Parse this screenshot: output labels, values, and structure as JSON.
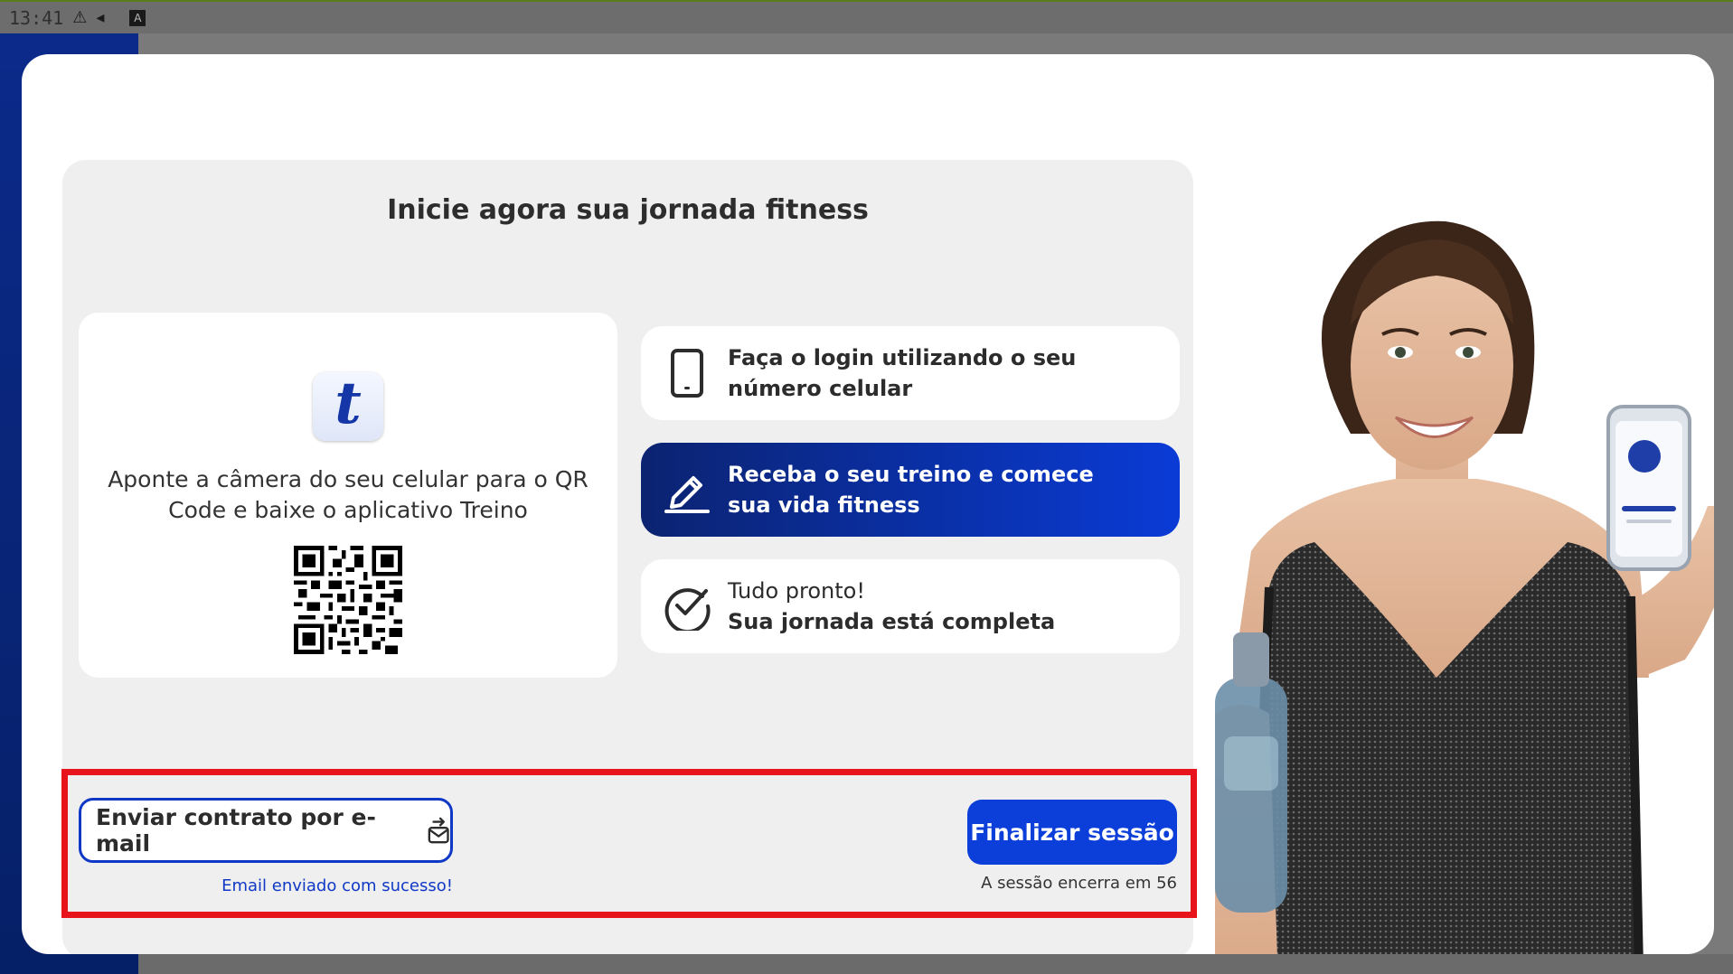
{
  "statusbar": {
    "time": "13:41",
    "warning_icon": "warning-icon",
    "sound_icon": "speaker-icon",
    "app_badge": "A"
  },
  "modal": {
    "title": "Inicie agora sua jornada fitness",
    "qr_card": {
      "logo_letter": "t",
      "instruction": "Aponte a câmera do seu celular para o QR Code e baixe o aplicativo Treino"
    },
    "steps": [
      {
        "icon": "smartphone-icon",
        "text": "Faça o login utilizando o seu número celular",
        "active": false
      },
      {
        "icon": "pencil-icon",
        "text": "Receba o seu treino e comece sua vida fitness",
        "active": true
      },
      {
        "icon": "check-circle-icon",
        "text_line1": "Tudo pronto!",
        "text_line2": "Sua jornada está completa",
        "active": false
      }
    ],
    "actions": {
      "email_button_label": "Enviar contrato por e-mail",
      "email_icon": "mail-send-icon",
      "email_status": "Email enviado com sucesso!",
      "finish_button_label": "Finalizar sessão",
      "session_timer": "A sessão encerra em 56"
    }
  },
  "colors": {
    "primary": "#0c3ed9",
    "dark_primary": "#0b2370",
    "highlight_frame": "#e8141b",
    "panel_bg": "#efefef"
  }
}
